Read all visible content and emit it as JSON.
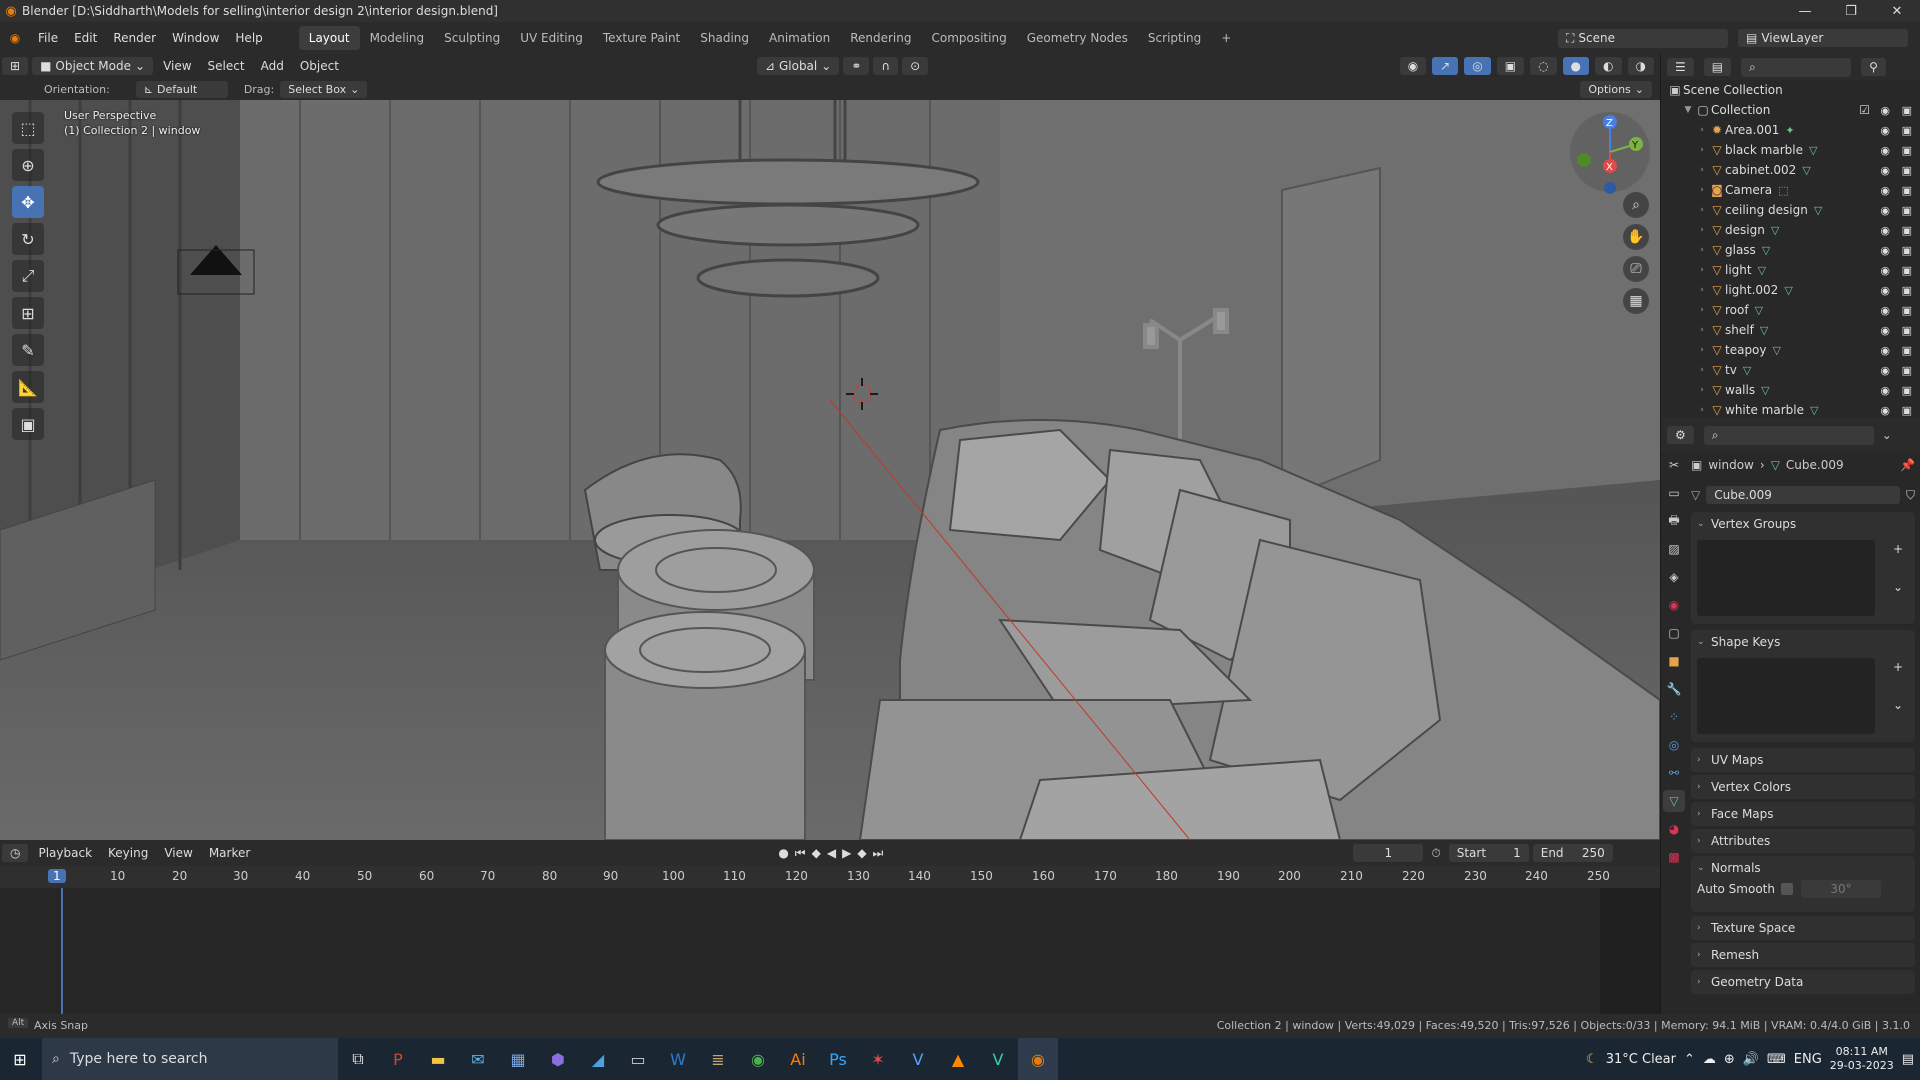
{
  "title_bar": {
    "text": "Blender [D:\\Siddharth\\Models for selling\\interior design 2\\interior design.blend]",
    "minimize": "—",
    "maximize": "❐",
    "close": "✕"
  },
  "menu": [
    "File",
    "Edit",
    "Render",
    "Window",
    "Help"
  ],
  "workspaces": [
    "Layout",
    "Modeling",
    "Sculpting",
    "UV Editing",
    "Texture Paint",
    "Shading",
    "Animation",
    "Rendering",
    "Compositing",
    "Geometry Nodes",
    "Scripting",
    "+"
  ],
  "active_workspace": "Layout",
  "scene": {
    "label": "Scene",
    "view_layer": "ViewLayer"
  },
  "header3d": {
    "mode": "Object Mode",
    "view": "View",
    "select": "Select",
    "add": "Add",
    "object": "Object",
    "transform": "Global"
  },
  "header3d2": {
    "orientation_label": "Orientation:",
    "orientation": "Default",
    "drag_label": "Drag:",
    "drag": "Select Box",
    "options": "Options"
  },
  "viewport_overlay": {
    "line1": "User Perspective",
    "line2": "(1) Collection 2 | window"
  },
  "gizmo": {
    "z": "Z",
    "y": "Y",
    "x": "X"
  },
  "timeline": {
    "playback": "Playback",
    "keying": "Keying",
    "view": "View",
    "marker": "Marker",
    "current_frame": "1",
    "start_label": "Start",
    "start": "1",
    "end_label": "End",
    "end": "250",
    "ticks": [
      "1",
      "10",
      "20",
      "30",
      "40",
      "50",
      "60",
      "70",
      "80",
      "90",
      "100",
      "110",
      "120",
      "130",
      "140",
      "150",
      "160",
      "170",
      "180",
      "190",
      "200",
      "210",
      "220",
      "230",
      "240",
      "250"
    ]
  },
  "outliner": {
    "scene_collection": "Scene Collection",
    "collection": "Collection",
    "items": [
      "Area.001",
      "black marble",
      "cabinet.002",
      "Camera",
      "ceiling design",
      "design",
      "glass",
      "light",
      "light.002",
      "roof",
      "shelf",
      "teapoy",
      "tv",
      "walls",
      "white marble"
    ]
  },
  "properties": {
    "breadcrumb_obj": "window",
    "breadcrumb_mesh": "Cube.009",
    "mesh_name": "Cube.009",
    "panels": [
      "Vertex Groups",
      "Shape Keys",
      "UV Maps",
      "Vertex Colors",
      "Face Maps",
      "Attributes",
      "Normals",
      "Texture Space",
      "Remesh",
      "Geometry Data"
    ],
    "auto_smooth_label": "Auto Smooth",
    "auto_smooth_angle": "30°"
  },
  "status": {
    "left": "Axis Snap",
    "right": "Collection 2 | window | Verts:49,029 | Faces:49,520 | Tris:97,526 | Objects:0/33 | Memory: 94.1 MiB | VRAM: 0.4/4.0 GiB | 3.1.0"
  },
  "taskbar": {
    "search_placeholder": "Type here to search",
    "weather": "31°C  Clear",
    "lang": "ENG",
    "time": "08:11 AM",
    "date": "29-03-2023"
  }
}
